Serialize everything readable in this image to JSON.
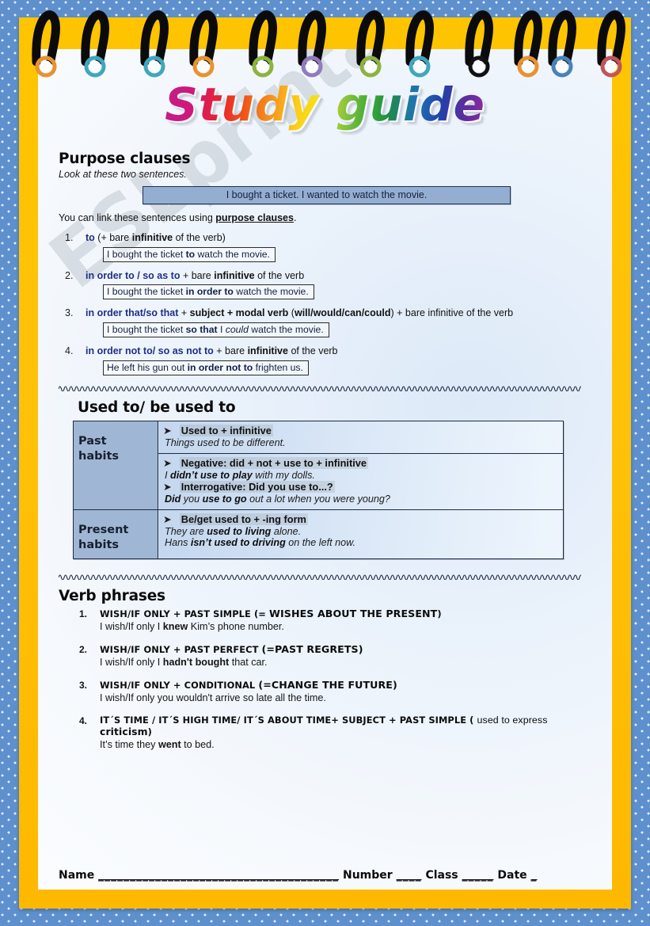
{
  "page": {
    "title": "Study guide",
    "watermark": "ESLprintables.com",
    "colors": {
      "polka_border": "#5d90cd",
      "gold_frame": "#ffc400",
      "page_bg": "#eaf2fb",
      "accent_blue_text": "#1f2f8a",
      "box_fill": "#94aed2",
      "table_label_fill": "#9fb6d4"
    },
    "spiral_ring_colors": [
      "#e8922f",
      "#3fa7bd",
      "#3fa7bd",
      "#e8922f",
      "#8db33f",
      "#8f7bbd",
      "#8db33f",
      "#3fa7bd",
      "#111111",
      "#e8922f",
      "#4a82b8",
      "#c0555c"
    ]
  },
  "purpose": {
    "heading": "Purpose clauses",
    "lead": "Look at these two sentences.",
    "sentence_box": "I bought a ticket. I wanted to watch the movie.",
    "linker_pre": "You can link these sentences using ",
    "linker_link": "purpose clauses",
    "linker_post": ".",
    "items": [
      {
        "num": "1.",
        "key": "to",
        "rule_rest": " (+ bare <b>infinitive</b> of the verb)",
        "example_html": "I bought the ticket<b> to</b> watch the movie."
      },
      {
        "num": "2.",
        "key": "in order to / so as to",
        "rule_rest": " + bare <b>infinitive</b> of the verb",
        "example_html": "I bought the ticket <b>in order to</b> watch the movie."
      },
      {
        "num": "3.",
        "key": "in order that/so that",
        "rule_rest": " + <b>subject + modal verb</b> (<b>will/would/can/could</b>) + bare infinitive of the verb",
        "example_html": "I bought the ticket <b>so that</b> I <i>could</i> watch the movie."
      },
      {
        "num": "4.",
        "key": "in order not to/ so as not to",
        "rule_rest": " + bare <b>infinitive</b> of the verb",
        "example_html": "He left his gun out <b>in order not to</b> frighten us."
      }
    ]
  },
  "used_to": {
    "heading": "Used to/ be used to",
    "rows": [
      {
        "label": "Past\nhabits",
        "label_line1": "Past",
        "label_line2": "habits",
        "blocks": [
          {
            "bullet": "Used to + infinitive",
            "examples": [
              "<i>Things used to be different.</i>"
            ]
          }
        ]
      },
      {
        "label_line1": "",
        "label_line2": "",
        "blocks": [
          {
            "bullet": "Negative: did + not + use to + infinitive",
            "examples": [
              "<i>I <b>didn’t use to play</b> with my dolls.</i>"
            ]
          },
          {
            "bullet": "Interrogative: Did you use to...?",
            "examples": [
              "<i><b>Did</b> you <b>use to go</b> out a lot when you were young?</i>"
            ]
          }
        ]
      },
      {
        "label_line1": "Present",
        "label_line2": "habits",
        "blocks": [
          {
            "bullet": "Be/get  used to + -ing form",
            "examples": [
              "<i>They are <b>used to living</b> alone.</i>",
              "<i>Hans <b>isn’t used to driving</b> on the left now.</i>"
            ]
          }
        ]
      }
    ]
  },
  "verb_phrases": {
    "heading": "Verb phrases",
    "items": [
      {
        "num": "1.",
        "head_html": "WISH/IF ONLY + PAST SIMPLE (= <span class=\"big\">WISHES ABOUT THE PRESENT</span>)",
        "example_html": "I wish/If only I <b>knew</b> Kim’s phone number."
      },
      {
        "num": "2.",
        "head_html": "WISH/IF ONLY + PAST PERFECT <span class=\"big\">(=PAST REGRETS)</span>",
        "example_html": "I wish/If only I <b>hadn't bought</b> that car."
      },
      {
        "num": "3.",
        "head_html": "WISH/IF ONLY + CONDITIONAL <span class=\"big\">(=CHANGE THE FUTURE)</span>",
        "example_html": "I wish/If only you wouldn't arrive so late all the time."
      },
      {
        "num": "4.",
        "head_html": "IT´S TIME / IT´S HIGH TIME/ IT´S ABOUT TIME+ SUBJECT + PAST SIMPLE ( <span style=\"font-family:'Liberation Sans',sans-serif;font-weight:400;font-size:12.4px\">used to express </span><span style=\"font-size:12.4px\">criticism</span>)",
        "example_html": "It’s time they <b>went</b> to bed."
      }
    ]
  },
  "footer": {
    "name_label": "Name",
    "name_blank": "______________________________________",
    "number_label": "Number",
    "number_blank": "____",
    "class_label": "Class",
    "class_blank": "_____",
    "date_label": "Date",
    "date_blank": "_"
  }
}
